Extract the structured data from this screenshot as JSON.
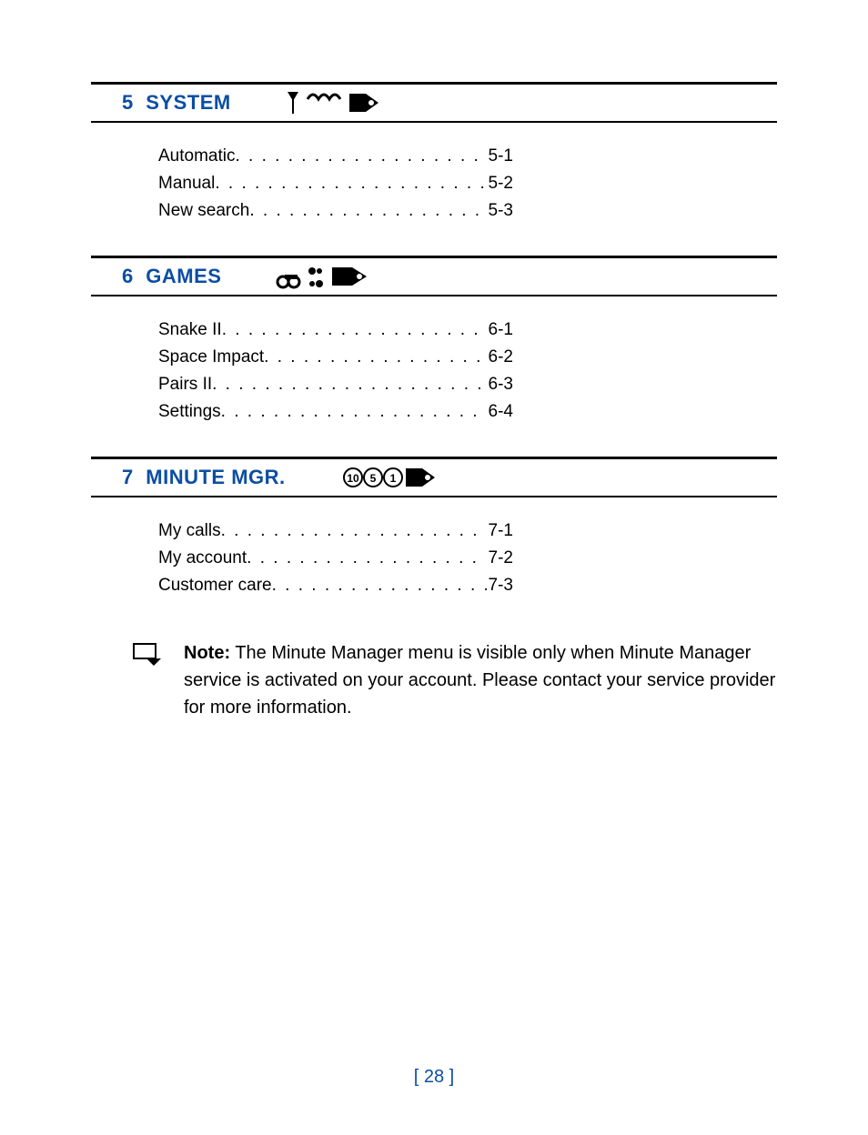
{
  "sections": [
    {
      "number": "5",
      "title": "SYSTEM",
      "iconset": "system",
      "items": [
        {
          "label": "Automatic",
          "page": "5-1"
        },
        {
          "label": "Manual",
          "page": "5-2"
        },
        {
          "label": "New search",
          "page": "5-3"
        }
      ]
    },
    {
      "number": "6",
      "title": "GAMES",
      "iconset": "games",
      "items": [
        {
          "label": "Snake II",
          "page": "6-1"
        },
        {
          "label": "Space Impact",
          "page": "6-2"
        },
        {
          "label": "Pairs II",
          "page": "6-3"
        },
        {
          "label": "Settings",
          "page": "6-4"
        }
      ]
    },
    {
      "number": "7",
      "title": "MINUTE MGR.",
      "iconset": "minmgr",
      "items": [
        {
          "label": "My calls",
          "page": "7-1"
        },
        {
          "label": "My account",
          "page": "7-2"
        },
        {
          "label": "Customer care",
          "page": "7-3"
        }
      ]
    }
  ],
  "note": {
    "label": "Note:",
    "text": "The Minute Manager menu is visible only when Minute Manager service is activated on your account. Please contact your service provider for more information."
  },
  "page_number": "[ 28 ]"
}
